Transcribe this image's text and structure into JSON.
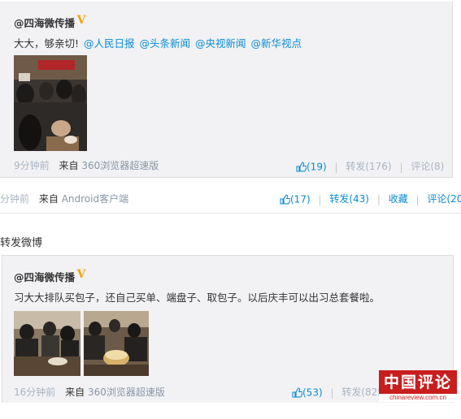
{
  "post1": {
    "username": "@四海微传播",
    "verified_badge": "V",
    "text": "大大，够亲切!",
    "mentions": [
      "@人民日报",
      "@头条新闻",
      "@央视新闻",
      "@新华视点"
    ],
    "time": "9分钟前",
    "source_prefix": "来自",
    "source": "360浏览器超速版",
    "like_count": "(19)",
    "repost_label": "转发(176)",
    "comment_label": "评论(8)"
  },
  "bar2": {
    "time": "分钟前",
    "source_prefix": "来自",
    "source": "Android客户端",
    "like_count": "(17)",
    "repost_label": "转发(43)",
    "collect_label": "收藏",
    "comment_label": "评论(20"
  },
  "section_title": "转发微博",
  "post2": {
    "username": "@四海微传播",
    "verified_badge": "V",
    "text": "习大大排队买包子，还自己买单、端盘子、取包子。以后庆丰可以出习总套餐啦。",
    "time": "16分钟前",
    "source_prefix": "来自",
    "source": "360浏览器超速版",
    "like_count": "(53)",
    "repost_label": "转发(825"
  },
  "watermark": {
    "brand": "中国评论网",
    "url": "chinareview.com.cn"
  },
  "colors": {
    "link": "#0a8cd2",
    "muted": "#aab4c0",
    "badge": "#f5a300",
    "watermark": "#c81e1e"
  }
}
